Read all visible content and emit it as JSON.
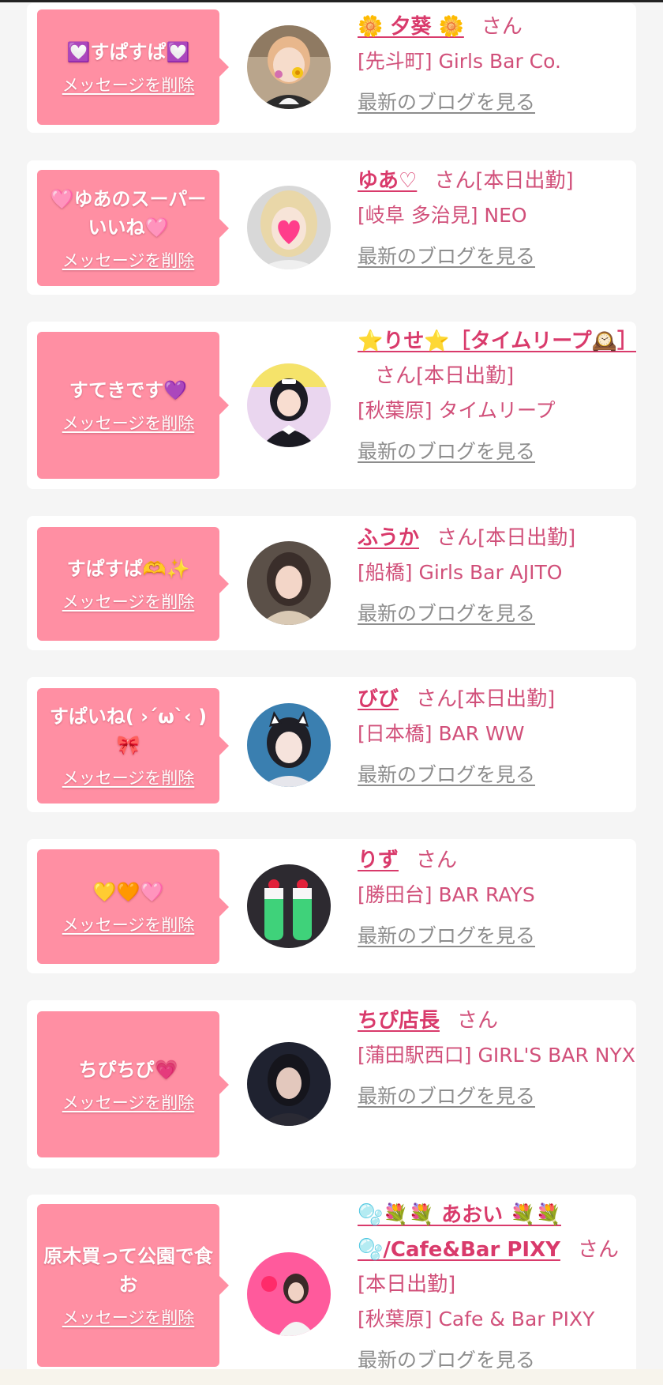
{
  "common": {
    "delete_label": "メッセージを削除",
    "blog_label": "最新のブログを見る",
    "honorific": "さん",
    "working_today": "[本日出勤]"
  },
  "colors": {
    "page_bg": "#f5f5f5",
    "card_bg": "#ffffff",
    "message_bubble": "#ff8fa3",
    "name_link": "#d93a6b",
    "shop_text": "#d1507a",
    "blog_link": "#8d8d8d"
  },
  "cards": [
    {
      "message": "💟すぱすぱ💟",
      "name": "🌼 夕葵 🌼",
      "working": "",
      "shop": "[先斗町] Girls Bar Co.",
      "avatar_icon": "girl-peace-sign-sticker-icon"
    },
    {
      "message": "🩷ゆあのスーパーいいね🩷",
      "name": "ゆあ♡",
      "working": "[本日出勤]",
      "shop": "[岐阜 多治見] NEO",
      "avatar_icon": "girl-heart-sticker-icon"
    },
    {
      "message": "すてきです💜",
      "name": "⭐りせ⭐［タイムリープ🕰️］",
      "working": "[本日出勤]",
      "shop": "[秋葉原] タイムリープ",
      "avatar_icon": "maid-girl-icon"
    },
    {
      "message": "すぱすぱ🫶✨",
      "name": "ふうか",
      "working": "[本日出勤]",
      "shop": "[船橋] Girls Bar AJITO",
      "avatar_icon": "girl-portrait-icon"
    },
    {
      "message": "すぱいね( ›´ω`‹ )🎀",
      "name": "びび",
      "working": "[本日出勤]",
      "shop": "[日本橋] BAR WW",
      "avatar_icon": "cat-ear-girl-icon"
    },
    {
      "message": "💛🧡🩷",
      "name": "りず",
      "working": "",
      "shop": "[勝田台] BAR RAYS",
      "avatar_icon": "melon-soda-drinks-icon"
    },
    {
      "message": "ちぴちぴ💗",
      "name": "ちぴ店長",
      "working": "",
      "shop": "[蒲田駅西口] GIRL'S BAR NYX",
      "avatar_icon": "dark-girl-portrait-icon"
    },
    {
      "message": "原木買って公園で食お",
      "name": "🫧💐💐 あおい 💐💐🫧/Cafe&Bar PIXY",
      "working": "[本日出勤]",
      "shop": "[秋葉原] Cafe & Bar PIXY",
      "avatar_icon": "girl-pink-wall-icon"
    }
  ]
}
